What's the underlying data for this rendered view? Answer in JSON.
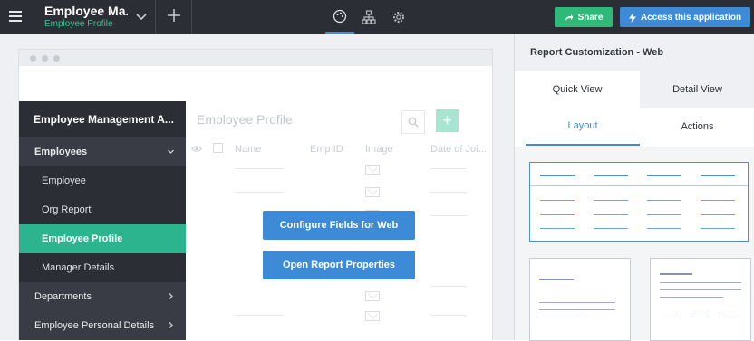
{
  "topbar": {
    "app_name": "Employee Ma...",
    "subtitle": "Employee Profile",
    "share_label": "Share",
    "access_label": "Access this application",
    "icons": [
      "menu-icon",
      "chevron-down-icon",
      "plus-icon",
      "palette-icon",
      "hierarchy-icon",
      "gear-icon"
    ]
  },
  "toolbar": {
    "devices": [
      "laptop-icon",
      "phone-icon",
      "tablet-icon"
    ],
    "tools": [
      "paint-bucket-icon",
      "list-settings-icon"
    ]
  },
  "sidebar": {
    "app_title": "Employee Management A...",
    "items": [
      {
        "label": "Employees",
        "type": "group",
        "arrow": "chevron-down-icon"
      },
      {
        "label": "Employee",
        "type": "sub"
      },
      {
        "label": "Org Report",
        "type": "sub"
      },
      {
        "label": "Employee Profile",
        "type": "sub",
        "active": true
      },
      {
        "label": "Manager Details",
        "type": "sub"
      },
      {
        "label": "Departments",
        "type": "group",
        "arrow": "chevron-right-icon"
      },
      {
        "label": "Employee Personal Details",
        "type": "group",
        "arrow": "chevron-right-icon"
      }
    ]
  },
  "report": {
    "title": "Employee Profile",
    "add_label": "+",
    "columns": [
      "Name",
      "Emp ID",
      "Image",
      "Date of Joi..."
    ],
    "configure_label": "Configure Fields for Web",
    "properties_label": "Open Report Properties"
  },
  "panel": {
    "title": "Report Customization - Web",
    "tabs": [
      "Quick View",
      "Detail View"
    ],
    "subtabs": [
      "Layout",
      "Actions"
    ]
  },
  "colors": {
    "topbar": "#2c2e36",
    "accent": "#3d8ad6",
    "share": "#2eb978",
    "active_item": "#2cb48f"
  }
}
